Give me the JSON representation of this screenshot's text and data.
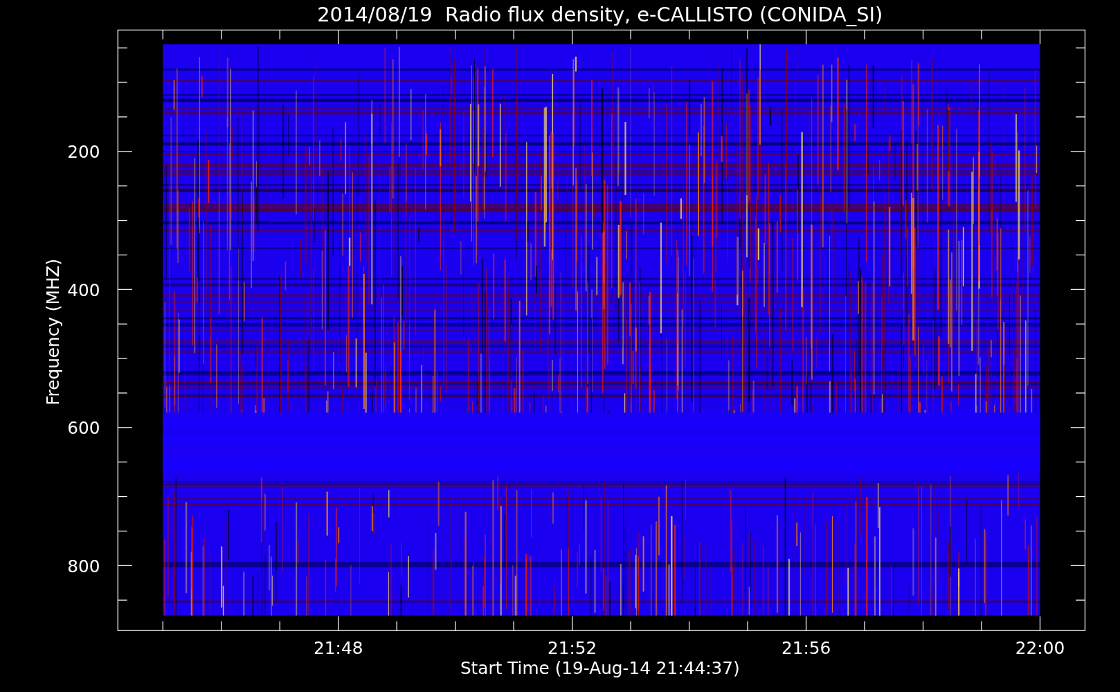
{
  "title": "2014/08/19  Radio flux density, e-CALLISTO (CONIDA_SI)",
  "y_axis": {
    "label": "Frequency (MHZ)",
    "ticks": [
      "200",
      "400",
      "600",
      "800"
    ]
  },
  "x_axis": {
    "label": "Start Time (19-Aug-14 21:44:37)",
    "ticks": [
      "21:48",
      "21:52",
      "21:56",
      "22:00"
    ]
  }
}
